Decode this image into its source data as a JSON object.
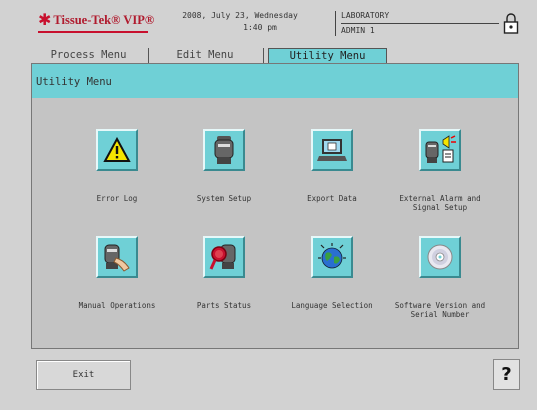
{
  "header": {
    "logo_text": "Tissue-Tek® VIP®",
    "date": "2008, July 23, Wednesday",
    "time": "1:40 pm",
    "location": "LABORATORY",
    "user": "ADMIN 1"
  },
  "tabs": [
    {
      "label": "Process Menu"
    },
    {
      "label": "Edit Menu"
    },
    {
      "label": "Utility Menu",
      "active": true
    }
  ],
  "panel": {
    "title": "Utility Menu"
  },
  "items": [
    {
      "label": "Error Log",
      "icon": "warning-icon"
    },
    {
      "label": "System Setup",
      "icon": "processor-icon"
    },
    {
      "label": "Export Data",
      "icon": "laptop-icon"
    },
    {
      "label": "External Alarm and\nSignal Setup",
      "icon": "alarm-icon"
    },
    {
      "label": "Manual Operations",
      "icon": "hand-icon"
    },
    {
      "label": "Parts Status",
      "icon": "magnifier-icon"
    },
    {
      "label": "Language Selection",
      "icon": "globe-icon"
    },
    {
      "label": "Software Version and\nSerial Number",
      "icon": "cd-icon"
    }
  ],
  "footer": {
    "exit_label": "Exit",
    "help_label": "?"
  },
  "colors": {
    "accent": "#6fd0d6",
    "brand": "#c8102e",
    "background": "#d2d2d2"
  }
}
